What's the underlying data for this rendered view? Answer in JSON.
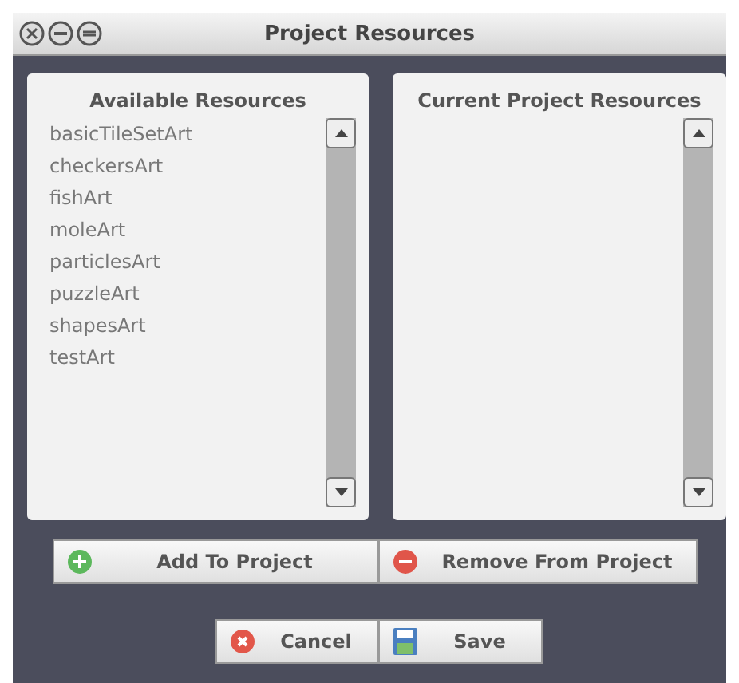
{
  "window": {
    "title": "Project Resources"
  },
  "panels": [
    {
      "title": "Available Resources",
      "items": [
        "basicTileSetArt",
        "checkersArt",
        "fishArt",
        "moleArt",
        "particlesArt",
        "puzzleArt",
        "shapesArt",
        "testArt"
      ]
    },
    {
      "title": "Current Project Resources"
    }
  ],
  "transfer_buttons": [
    {
      "label": "Add To Project",
      "kind": "add"
    },
    {
      "label": "Remove From Project",
      "kind": "remove"
    }
  ],
  "dialog_buttons": [
    {
      "label": "Cancel",
      "kind": "cancel"
    },
    {
      "label": "Save",
      "kind": "save"
    }
  ]
}
